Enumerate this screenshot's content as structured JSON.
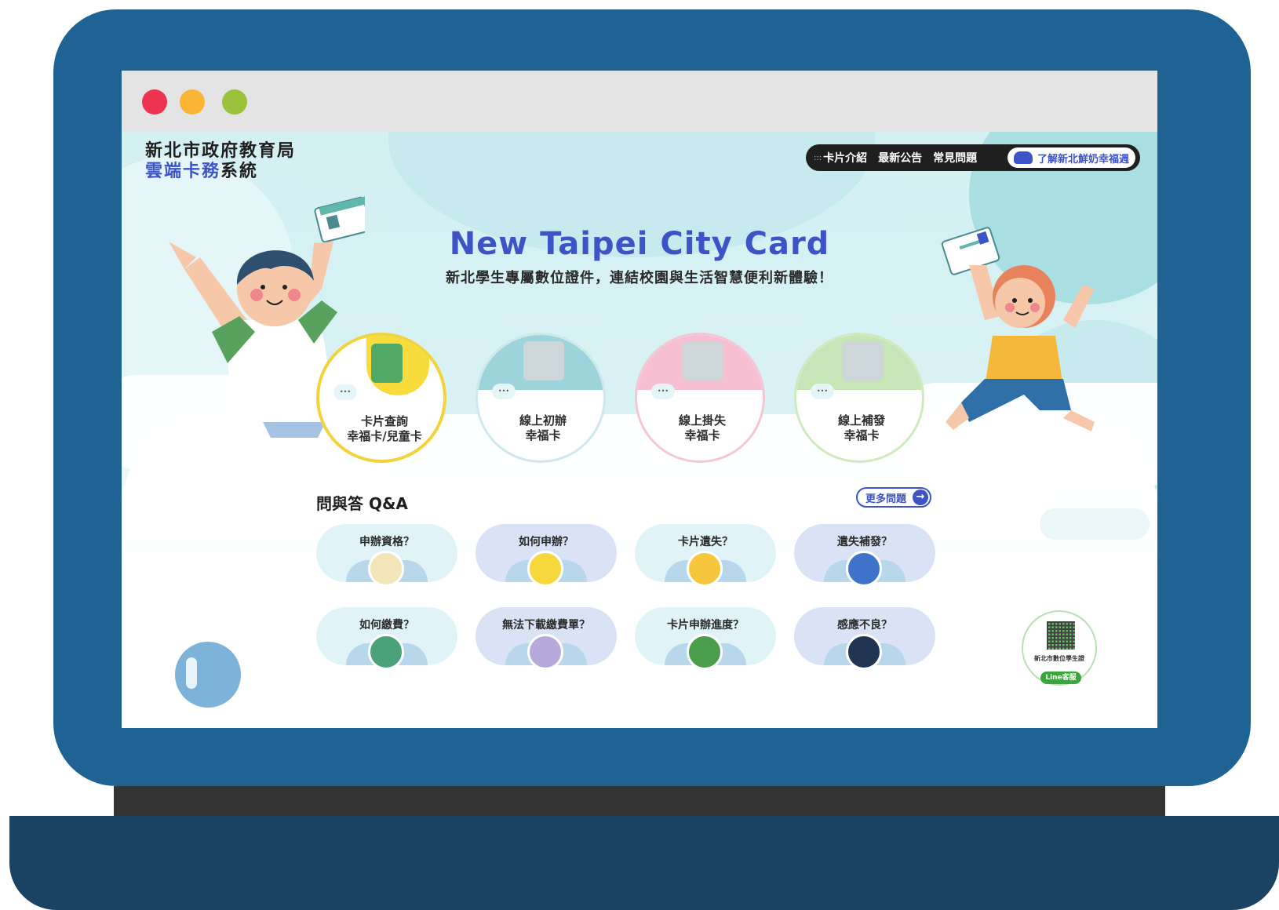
{
  "colors": {
    "laptop_frame": "#1e6393",
    "laptop_base": "#1a4262",
    "brand_blue": "#3d54c6",
    "traffic_red": "#ee3350",
    "traffic_yellow": "#f9b533",
    "traffic_green": "#9ac33b"
  },
  "brand": {
    "line1": "新北市政府教育局",
    "line2_accent": "雲端卡務",
    "line2_rest": "系統"
  },
  "nav": {
    "menu_icon": "grid-menu-icon",
    "items": [
      "卡片介紹",
      "最新公告",
      "常見問題"
    ],
    "pill_icon": "milk-cow-icon",
    "pill_label": "了解新北鮮奶幸福週"
  },
  "hero": {
    "title": "New Taipei City Card",
    "subtitle": "新北學生專屬數位證件，連結校園與生活智慧便利新體驗！"
  },
  "services": [
    {
      "line1": "卡片查詢",
      "line2": "幸福卡/兒童卡",
      "icon": "document-search-icon"
    },
    {
      "line1": "線上初辦",
      "line2": "幸福卡",
      "icon": "taipei-city-card-icon"
    },
    {
      "line1": "線上掛失",
      "line2": "幸福卡",
      "icon": "taipei-city-card-icon"
    },
    {
      "line1": "線上補發",
      "line2": "幸福卡",
      "icon": "taipei-city-card-icon"
    }
  ],
  "qa": {
    "title": "問與答 Q&A",
    "more_label": "更多問題",
    "items": [
      {
        "label": "申辦資格？",
        "icon": "application-checklist-icon"
      },
      {
        "label": "如何申辦？",
        "icon": "question-form-icon"
      },
      {
        "label": "卡片遺失？",
        "icon": "lost-card-icon"
      },
      {
        "label": "遺失補發？",
        "icon": "reissue-card-icon"
      },
      {
        "label": "如何繳費？",
        "icon": "payment-icon"
      },
      {
        "label": "無法下載繳費單？",
        "icon": "download-blocked-icon"
      },
      {
        "label": "卡片申辦進度？",
        "icon": "card-progress-icon"
      },
      {
        "label": "感應不良？",
        "icon": "nfc-error-icon"
      }
    ]
  },
  "line_service": {
    "caption": "新北市數位學生證",
    "button_label": "Line客服"
  }
}
